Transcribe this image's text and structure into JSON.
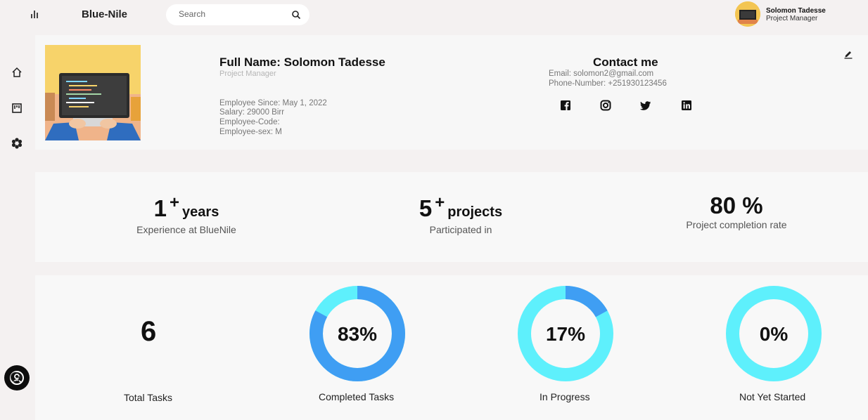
{
  "app": {
    "brand": "Blue-Nile"
  },
  "search": {
    "placeholder": "Search"
  },
  "user": {
    "name": "Solomon Tadesse",
    "role": "Project Manager"
  },
  "profile": {
    "full_name": "Full Name: Solomon Tadesse",
    "title": "Project Manager",
    "employee_since": "Employee Since: May 1, 2022",
    "salary": "Salary: 29000 Birr",
    "employee_code": "Employee-Code:",
    "employee_sex": "Employee-sex: M"
  },
  "contact": {
    "heading": "Contact me",
    "email": "Email: solomon2@gmail.com",
    "phone": "Phone-Number: +251930123456",
    "socials": [
      "facebook-icon",
      "instagram-icon",
      "twitter-icon",
      "linkedin-icon"
    ]
  },
  "stats": {
    "experience": {
      "value": "1",
      "plus": "+",
      "unit": "years",
      "caption": "Experience at BlueNile"
    },
    "projects": {
      "value": "5",
      "plus": "+",
      "unit": "projects",
      "caption": "Participated in"
    },
    "completion": {
      "value": "80 %",
      "caption": "Project completion rate"
    }
  },
  "tasks": {
    "total": {
      "value": "6",
      "label": "Total Tasks"
    },
    "completed": {
      "percent": 83,
      "text": "83%",
      "label": "Completed Tasks"
    },
    "in_progress": {
      "percent": 17,
      "text": "17%",
      "label": "In Progress"
    },
    "not_started": {
      "percent": 0,
      "text": "0%",
      "label": "Not Yet Started"
    }
  },
  "colors": {
    "ring_light": "#5ef0fc",
    "ring_dark": "#3f9ef3"
  }
}
